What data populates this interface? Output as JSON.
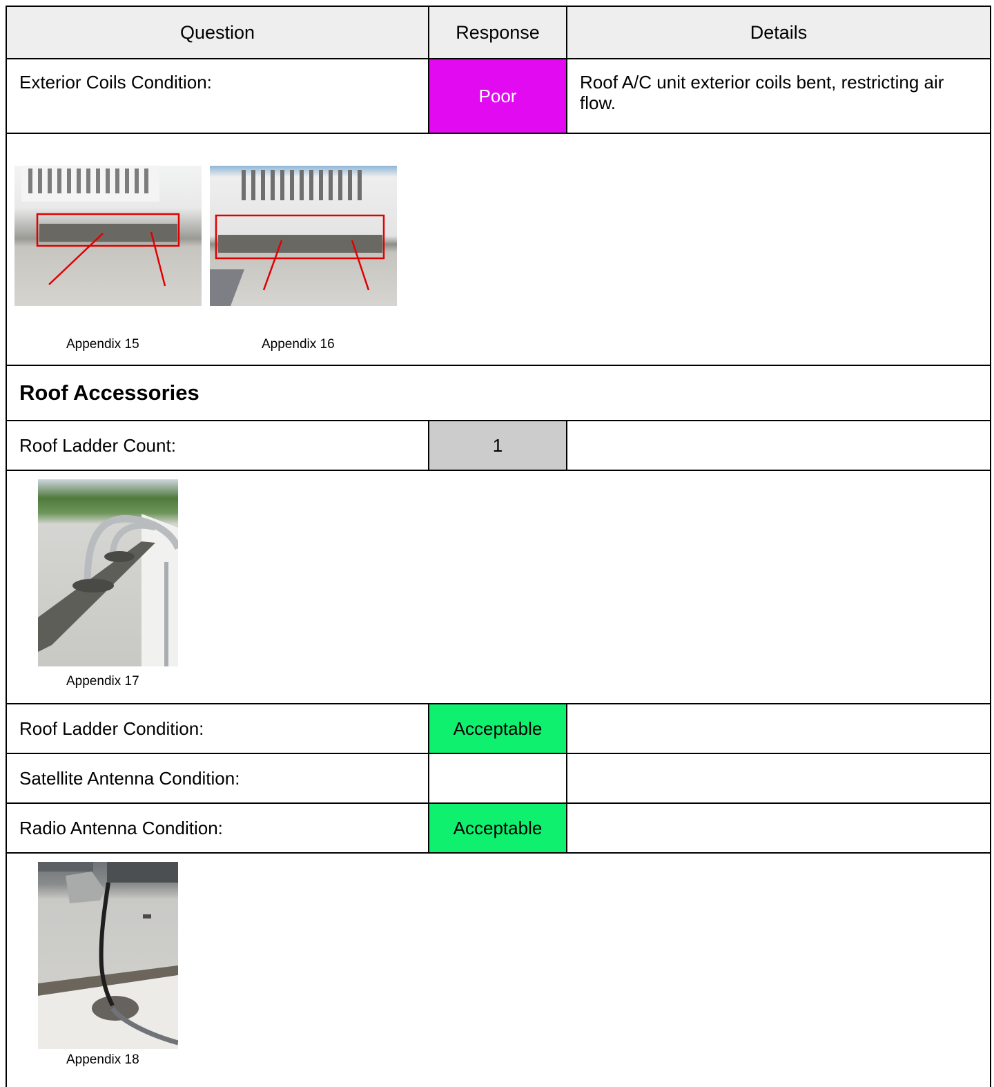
{
  "header": {
    "question": "Question",
    "response": "Response",
    "details": "Details"
  },
  "exterior_coils": {
    "question": "Exterior Coils Condition:",
    "response": "Poor",
    "details": "Roof A/C unit exterior coils bent, restricting air flow.",
    "response_color": "#e10af0"
  },
  "coil_photos": [
    {
      "caption": "Appendix 15"
    },
    {
      "caption": "Appendix 16"
    }
  ],
  "section": {
    "title": "Roof Accessories"
  },
  "ladder_count": {
    "question": "Roof Ladder Count:",
    "response": "1",
    "details": "",
    "response_color": "#cccccc"
  },
  "ladder_photo": {
    "caption": "Appendix 17"
  },
  "ladder_condition": {
    "question": "Roof Ladder Condition:",
    "response": "Acceptable",
    "details": "",
    "response_color": "#0ff06f"
  },
  "satellite_condition": {
    "question": "Satellite Antenna Condition:",
    "response": "",
    "details": ""
  },
  "radio_condition": {
    "question": "Radio Antenna Condition:",
    "response": "Acceptable",
    "details": "",
    "response_color": "#0ff06f"
  },
  "antenna_photo": {
    "caption": "Appendix 18"
  }
}
